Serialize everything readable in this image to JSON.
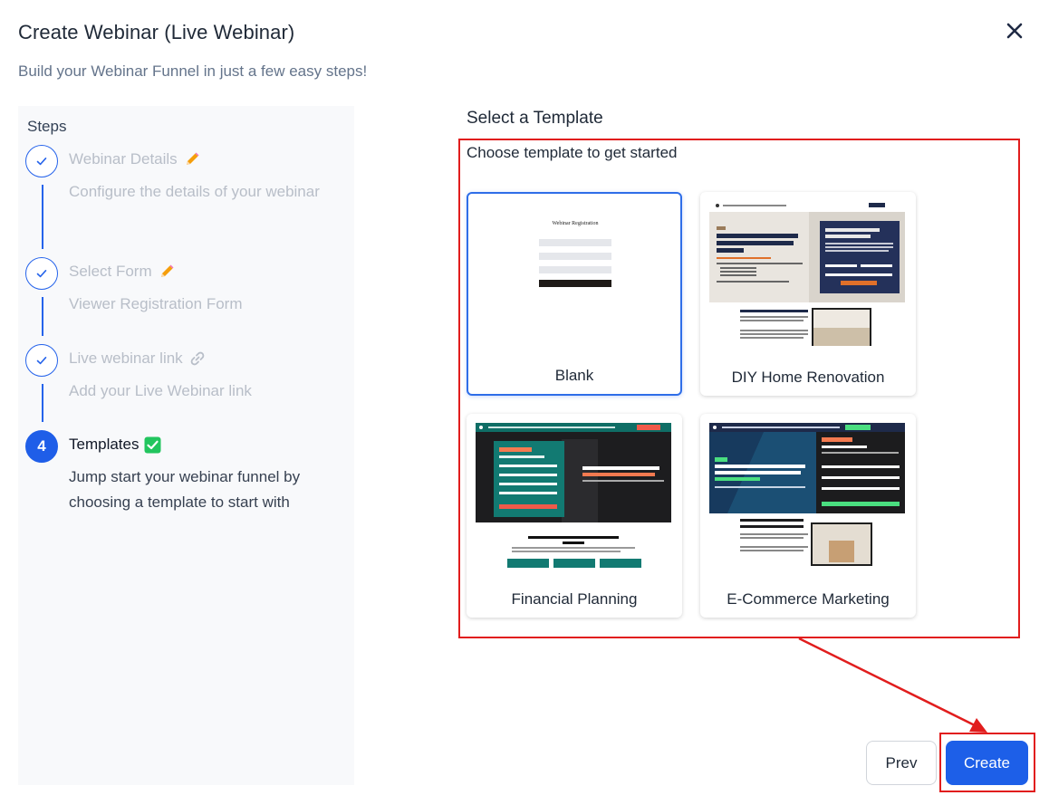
{
  "modal": {
    "title": "Create Webinar (Live Webinar)",
    "subtitle": "Build your Webinar Funnel in just a few easy steps!"
  },
  "steps": {
    "heading": "Steps",
    "items": [
      {
        "title": "Webinar Details",
        "description": "Configure the details of your webinar",
        "status": "completed",
        "icon": "pencil-icon"
      },
      {
        "title": "Select Form",
        "description": "Viewer Registration Form",
        "status": "completed",
        "icon": "pencil-icon"
      },
      {
        "title": "Live webinar link",
        "description": "Add your Live Webinar link",
        "status": "completed",
        "icon": "link-icon"
      },
      {
        "number": "4",
        "title": "Templates",
        "description": "Jump start your webinar funnel by choosing a template to start with",
        "status": "active",
        "icon": "check-box-icon"
      }
    ]
  },
  "templates": {
    "heading": "Select a Template",
    "instruction": "Choose template to get started",
    "items": [
      {
        "label": "Blank",
        "selected": true,
        "preview_heading": "Webinar Registration"
      },
      {
        "label": "DIY Home Renovation",
        "selected": false
      },
      {
        "label": "Financial Planning",
        "selected": false
      },
      {
        "label": "E-Commerce Marketing",
        "selected": false
      }
    ]
  },
  "actions": {
    "prev_label": "Prev",
    "create_label": "Create"
  },
  "colors": {
    "primary": "#1d5fe8",
    "highlight": "#e11d1d",
    "completed_check": "#22c55e"
  }
}
